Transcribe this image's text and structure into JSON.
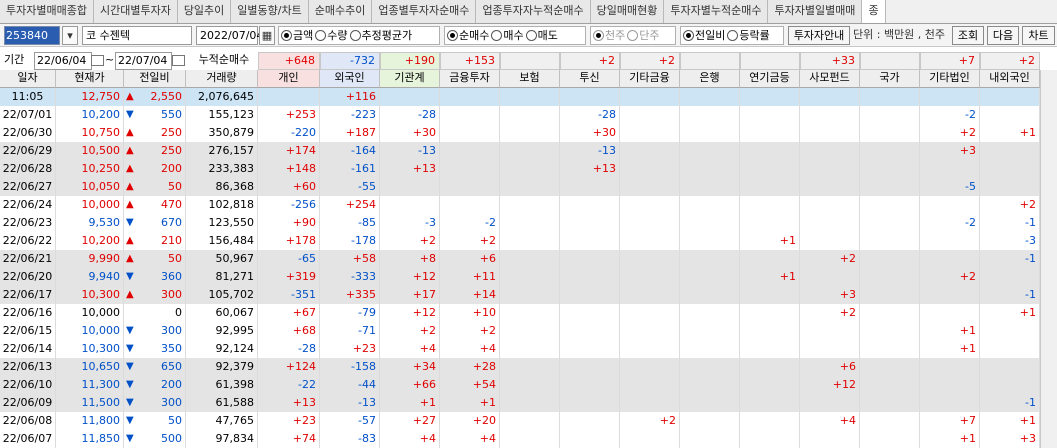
{
  "tabs": [
    "투자자별매매종합",
    "시간대별투자자",
    "당일추이",
    "일별동향/차트",
    "순매수추이",
    "업종별투자자순매수",
    "업종투자자누적순매수",
    "당일매매현황",
    "투자자별누적순매수",
    "투자자별일별매매",
    "종"
  ],
  "active_tab": 10,
  "toolbar": {
    "code": "253840",
    "name": "코 수젠텍",
    "date": "2022/07/04",
    "radio_group1": [
      "금액",
      "수량",
      "추정평균가"
    ],
    "radio_group2": [
      "순매수",
      "매수",
      "매도"
    ],
    "radio_group3": [
      "천주",
      "단주"
    ],
    "radio_group4": [
      "전일비",
      "등락률"
    ],
    "guide_button": "투자자안내",
    "unit_label": "단위 : 백만원 , 천주",
    "search_button": "조회",
    "next_button": "다음",
    "chart_button": "차트"
  },
  "filter": {
    "period_label": "기간",
    "from_date": "22/06/04",
    "to_date": "22/07/04",
    "sep": "~",
    "cumulative_label": "누적순매수",
    "sums": [
      "+648",
      "-732",
      "+190",
      "+153",
      "",
      "+2",
      "+2",
      "",
      "",
      "+33",
      "",
      "+7",
      "+2"
    ]
  },
  "columns": [
    "일자",
    "현재가",
    "전일비",
    "거래량",
    "개인",
    "외국인",
    "기관계",
    "금융투자",
    "보험",
    "투신",
    "기타금융",
    "은행",
    "연기금등",
    "사모펀드",
    "국가",
    "기타법인",
    "내외국인"
  ],
  "rows": [
    [
      "11:05",
      "12,750",
      "up",
      "2,550",
      "2,076,645",
      "",
      "+116",
      "",
      "",
      "",
      "",
      "",
      "",
      "",
      "",
      "",
      "",
      ""
    ],
    [
      "22/07/01",
      "10,200",
      "down",
      "550",
      "155,123",
      "+253",
      "-223",
      "-28",
      "",
      "",
      "-28",
      "",
      "",
      "",
      "",
      "",
      "-2",
      ""
    ],
    [
      "22/06/30",
      "10,750",
      "up",
      "250",
      "350,879",
      "-220",
      "+187",
      "+30",
      "",
      "",
      "+30",
      "",
      "",
      "",
      "",
      "",
      "+2",
      "+1"
    ],
    [
      "22/06/29",
      "10,500",
      "up",
      "250",
      "276,157",
      "+174",
      "-164",
      "-13",
      "",
      "",
      "-13",
      "",
      "",
      "",
      "",
      "",
      "+3",
      ""
    ],
    [
      "22/06/28",
      "10,250",
      "up",
      "200",
      "233,383",
      "+148",
      "-161",
      "+13",
      "",
      "",
      "+13",
      "",
      "",
      "",
      "",
      "",
      "",
      ""
    ],
    [
      "22/06/27",
      "10,050",
      "up",
      "50",
      "86,368",
      "+60",
      "-55",
      "",
      "",
      "",
      "",
      "",
      "",
      "",
      "",
      "",
      "-5",
      ""
    ],
    [
      "22/06/24",
      "10,000",
      "up",
      "470",
      "102,818",
      "-256",
      "+254",
      "",
      "",
      "",
      "",
      "",
      "",
      "",
      "",
      "",
      "",
      "+2"
    ],
    [
      "22/06/23",
      "9,530",
      "down",
      "670",
      "123,550",
      "+90",
      "-85",
      "-3",
      "-2",
      "",
      "",
      "",
      "",
      "",
      "",
      "",
      "-2",
      "-1"
    ],
    [
      "22/06/22",
      "10,200",
      "up",
      "210",
      "156,484",
      "+178",
      "-178",
      "+2",
      "+2",
      "",
      "",
      "",
      "",
      "+1",
      "",
      "",
      "",
      "-3"
    ],
    [
      "22/06/21",
      "9,990",
      "up",
      "50",
      "50,967",
      "-65",
      "+58",
      "+8",
      "+6",
      "",
      "",
      "",
      "",
      "",
      "+2",
      "",
      "",
      "-1"
    ],
    [
      "22/06/20",
      "9,940",
      "down",
      "360",
      "81,271",
      "+319",
      "-333",
      "+12",
      "+11",
      "",
      "",
      "",
      "",
      "+1",
      "",
      "",
      "+2",
      ""
    ],
    [
      "22/06/17",
      "10,300",
      "up",
      "300",
      "105,702",
      "-351",
      "+335",
      "+17",
      "+14",
      "",
      "",
      "",
      "",
      "",
      "+3",
      "",
      "",
      "-1"
    ],
    [
      "22/06/16",
      "10,000",
      "zero",
      "0",
      "60,067",
      "+67",
      "-79",
      "+12",
      "+10",
      "",
      "",
      "",
      "",
      "",
      "+2",
      "",
      "",
      "+1"
    ],
    [
      "22/06/15",
      "10,000",
      "down",
      "300",
      "92,995",
      "+68",
      "-71",
      "+2",
      "+2",
      "",
      "",
      "",
      "",
      "",
      "",
      "",
      "+1",
      ""
    ],
    [
      "22/06/14",
      "10,300",
      "down",
      "350",
      "92,124",
      "-28",
      "+23",
      "+4",
      "+4",
      "",
      "",
      "",
      "",
      "",
      "",
      "",
      "+1",
      ""
    ],
    [
      "22/06/13",
      "10,650",
      "down",
      "650",
      "92,379",
      "+124",
      "-158",
      "+34",
      "+28",
      "",
      "",
      "",
      "",
      "",
      "+6",
      "",
      "",
      ""
    ],
    [
      "22/06/10",
      "11,300",
      "down",
      "200",
      "61,398",
      "-22",
      "-44",
      "+66",
      "+54",
      "",
      "",
      "",
      "",
      "",
      "+12",
      "",
      "",
      ""
    ],
    [
      "22/06/09",
      "11,500",
      "down",
      "300",
      "61,588",
      "+13",
      "-13",
      "+1",
      "+1",
      "",
      "",
      "",
      "",
      "",
      "",
      "",
      "",
      "-1"
    ],
    [
      "22/06/08",
      "11,800",
      "down",
      "50",
      "47,765",
      "+23",
      "-57",
      "+27",
      "+20",
      "",
      "",
      "+2",
      "",
      "",
      "+4",
      "",
      "+7",
      "+1"
    ],
    [
      "22/06/07",
      "11,850",
      "down",
      "500",
      "97,834",
      "+74",
      "-83",
      "+4",
      "+4",
      "",
      "",
      "",
      "",
      "",
      "",
      "",
      "+1",
      "+3"
    ]
  ],
  "icons": {
    "search": "magnifier-icon",
    "calendar": "calendar-icon",
    "dropdown": "dropdown-icon",
    "up": "up-triangle-icon",
    "down": "down-triangle-icon"
  },
  "colors": {
    "up": "#e00000",
    "down": "#0050c8",
    "selected_row": "#cce4f4",
    "alt_row": "#e4e4e4"
  }
}
